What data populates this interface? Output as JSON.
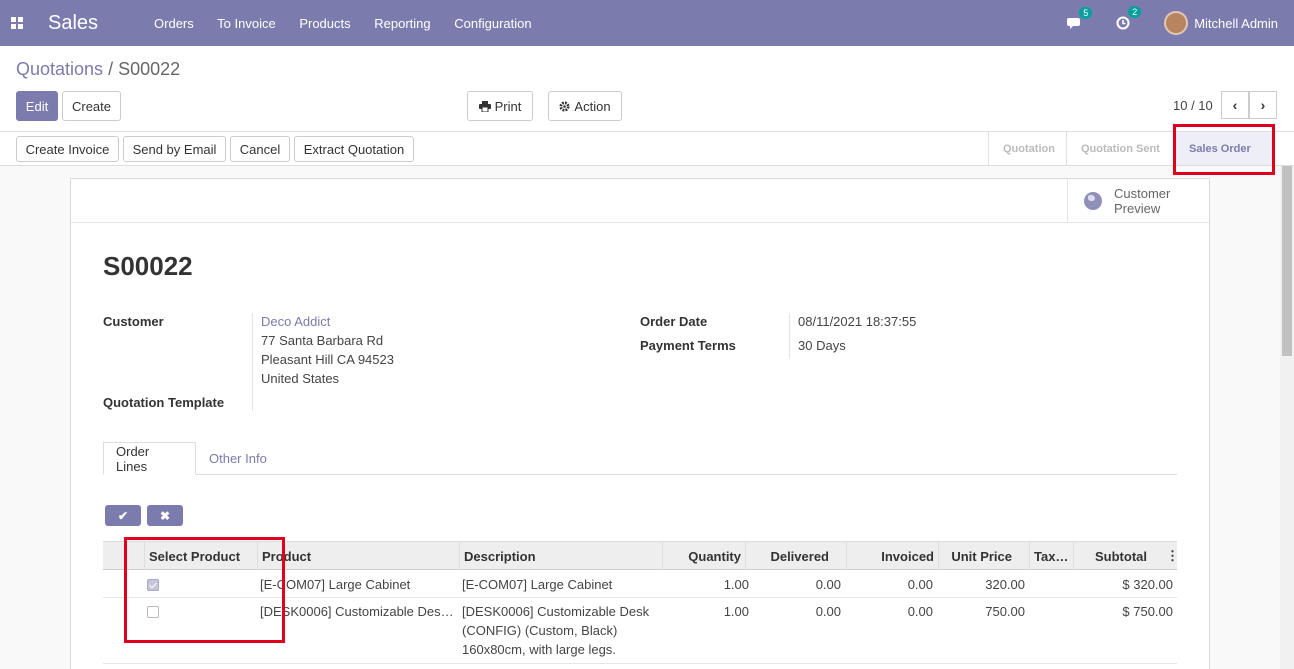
{
  "navbar": {
    "app_name": "Sales",
    "menu": [
      "Orders",
      "To Invoice",
      "Products",
      "Reporting",
      "Configuration"
    ],
    "messages_count": "5",
    "activities_count": "2",
    "user_name": "Mitchell Admin",
    "color": "#7c7bad"
  },
  "breadcrumb": {
    "parent": "Quotations",
    "separator": " / ",
    "current": "S00022"
  },
  "buttons": {
    "edit": "Edit",
    "create": "Create",
    "print": "Print",
    "action": "Action",
    "pager": "10 / 10"
  },
  "statusbar": {
    "actions": [
      "Create Invoice",
      "Send by Email",
      "Cancel",
      "Extract Quotation"
    ],
    "stages": [
      "Quotation",
      "Quotation Sent",
      "Sales Order"
    ],
    "active_stage": "Sales Order"
  },
  "sheet": {
    "preview_label": "Customer Preview",
    "title": "S00022",
    "customer_label": "Customer",
    "customer_name": "Deco Addict",
    "address": [
      "77 Santa Barbara Rd",
      "Pleasant Hill CA 94523",
      "United States"
    ],
    "template_label": "Quotation Template",
    "order_date_label": "Order Date",
    "order_date": "08/11/2021 18:37:55",
    "payment_terms_label": "Payment Terms",
    "payment_terms": "30 Days"
  },
  "tabs": [
    "Order Lines",
    "Other Info"
  ],
  "table": {
    "columns": [
      "Select Product",
      "Product",
      "Description",
      "Quantity",
      "Delivered",
      "Invoiced",
      "Unit Price",
      "Tax…",
      "Subtotal"
    ],
    "rows": [
      {
        "selected": true,
        "product": "[E-COM07] Large Cabinet",
        "description": [
          "[E-COM07] Large Cabinet"
        ],
        "quantity": "1.00",
        "delivered": "0.00",
        "invoiced": "0.00",
        "unit_price": "320.00",
        "taxes": "",
        "subtotal": "$ 320.00"
      },
      {
        "selected": false,
        "product": "[DESK0006] Customizable Des…",
        "description": [
          "[DESK0006] Customizable Desk",
          "(CONFIG) (Custom, Black)",
          "160x80cm, with large legs."
        ],
        "quantity": "1.00",
        "delivered": "0.00",
        "invoiced": "0.00",
        "unit_price": "750.00",
        "taxes": "",
        "subtotal": "$ 750.00"
      }
    ]
  }
}
